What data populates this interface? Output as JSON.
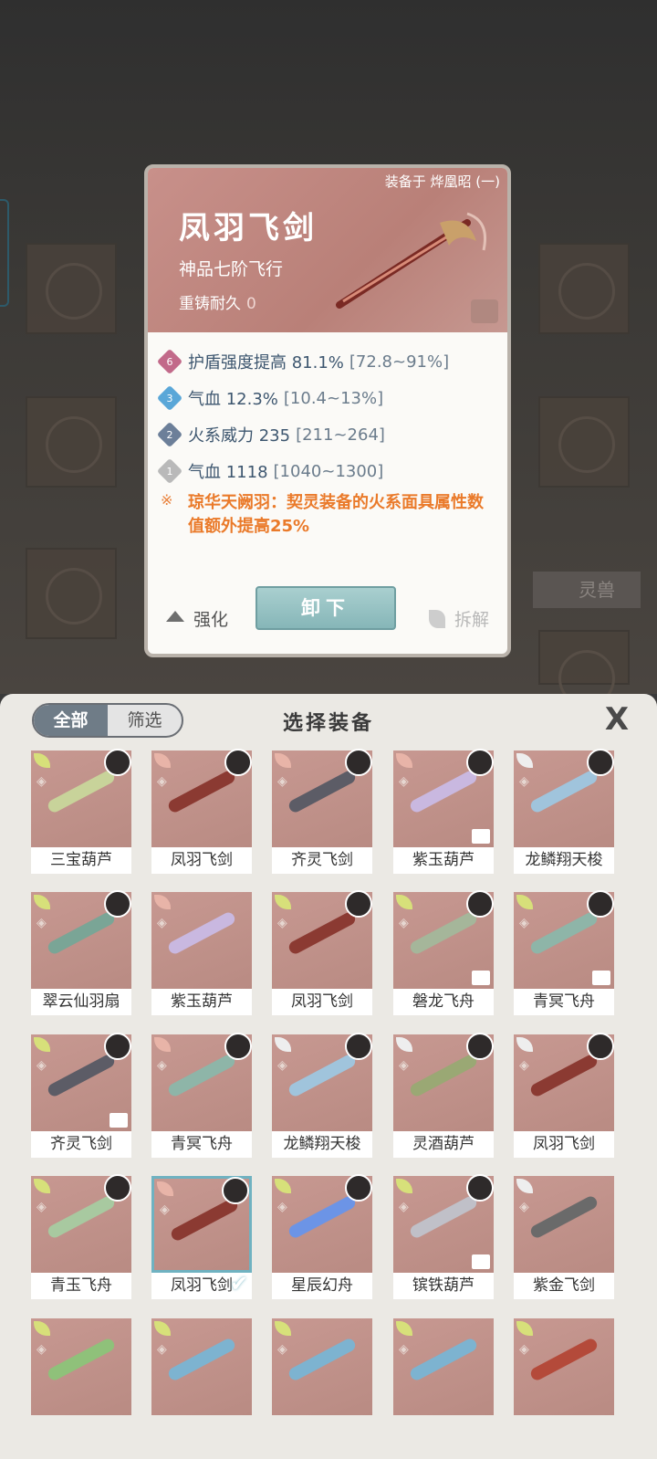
{
  "detail": {
    "equipped_on": "装备于 烨凰昭 (一)",
    "name": "凤羽飞剑",
    "grade": "神品七阶飞行",
    "recast_label": "重铸耐久",
    "recast_value": "0",
    "stats": [
      {
        "badge": "6",
        "name": "护盾强度提高 81.1%",
        "range": "[72.8~91%]",
        "color": "#c26a8a"
      },
      {
        "badge": "3",
        "name": "气血 12.3%",
        "range": "[10.4~13%]",
        "color": "#5aa7d8"
      },
      {
        "badge": "2",
        "name": "火系威力 235",
        "range": "[211~264]",
        "color": "#6c7f99"
      },
      {
        "badge": "1",
        "name": "气血 1118",
        "range": "[1040~1300]",
        "color": "#b9b9b9"
      }
    ],
    "set_bonus": "琼华天阙羽：契灵装备的火系面具属性数值额外提高25%",
    "enhance_label": "强化",
    "unequip_label": "卸下",
    "dismantle_label": "拆解"
  },
  "panel": {
    "tab_all": "全部",
    "tab_filter": "筛选",
    "title": "选择装备",
    "close_symbol": "X"
  },
  "items": [
    {
      "name": "三宝葫芦",
      "wing": "#d7e07a",
      "avatar": true,
      "color": "#c8d39a",
      "lock": false
    },
    {
      "name": "凤羽飞剑",
      "wing": "#e8b4a8",
      "avatar": true,
      "color": "#8b3a32",
      "lock": false
    },
    {
      "name": "齐灵飞剑",
      "wing": "#e8b4a8",
      "avatar": true,
      "color": "#5c5c66",
      "lock": false
    },
    {
      "name": "紫玉葫芦",
      "wing": "#e8b4a8",
      "avatar": true,
      "color": "#c9b8e0",
      "lock": true
    },
    {
      "name": "龙鳞翔天梭",
      "wing": "#eeeeee",
      "avatar": true,
      "color": "#a0c4dc",
      "lock": false
    },
    {
      "name": "翠云仙羽扇",
      "wing": "#d7e07a",
      "avatar": true,
      "color": "#7aa596",
      "lock": false
    },
    {
      "name": "紫玉葫芦",
      "wing": "#e8b4a8",
      "avatar": false,
      "color": "#c9b8e0",
      "lock": false
    },
    {
      "name": "凤羽飞剑",
      "wing": "#d7e07a",
      "avatar": true,
      "color": "#8b3a32",
      "lock": false
    },
    {
      "name": "磐龙飞舟",
      "wing": "#d7e07a",
      "avatar": true,
      "color": "#a5b69a",
      "lock": true
    },
    {
      "name": "青冥飞舟",
      "wing": "#d7e07a",
      "avatar": true,
      "color": "#8eb5a8",
      "lock": true
    },
    {
      "name": "齐灵飞剑",
      "wing": "#d7e07a",
      "avatar": true,
      "color": "#5c5c66",
      "lock": true
    },
    {
      "name": "青冥飞舟",
      "wing": "#e8b4a8",
      "avatar": true,
      "color": "#8eb5a8",
      "lock": false
    },
    {
      "name": "龙鳞翔天梭",
      "wing": "#eeeeee",
      "avatar": true,
      "color": "#a0c4dc",
      "lock": false
    },
    {
      "name": "灵酒葫芦",
      "wing": "#eeeeee",
      "avatar": true,
      "color": "#9aa874",
      "lock": false
    },
    {
      "name": "凤羽飞剑",
      "wing": "#eeeeee",
      "avatar": true,
      "color": "#8b3a32",
      "lock": false
    },
    {
      "name": "青玉飞舟",
      "wing": "#d7e07a",
      "avatar": true,
      "color": "#a8c9a0",
      "lock": false
    },
    {
      "name": "凤羽飞剑",
      "wing": "#e8b4a8",
      "avatar": true,
      "color": "#8b3a32",
      "lock": false,
      "selected": true
    },
    {
      "name": "星辰幻舟",
      "wing": "#d7e07a",
      "avatar": true,
      "color": "#6c94e6",
      "lock": false
    },
    {
      "name": "镔铁葫芦",
      "wing": "#d7e07a",
      "avatar": true,
      "color": "#c0c0c8",
      "lock": true
    },
    {
      "name": "紫金飞剑",
      "wing": "#eeeeee",
      "avatar": false,
      "color": "#6a6a6a",
      "lock": false
    },
    {
      "name": "",
      "wing": "#d7e07a",
      "avatar": false,
      "color": "#8fc17a",
      "lock": false
    },
    {
      "name": "",
      "wing": "#d7e07a",
      "avatar": false,
      "color": "#7db3d0",
      "lock": false
    },
    {
      "name": "",
      "wing": "#d7e07a",
      "avatar": false,
      "color": "#7db3d0",
      "lock": false
    },
    {
      "name": "",
      "wing": "#d7e07a",
      "avatar": false,
      "color": "#7db3d0",
      "lock": false
    },
    {
      "name": "",
      "wing": "#d7e07a",
      "avatar": false,
      "color": "#b44a3a",
      "lock": false
    }
  ]
}
